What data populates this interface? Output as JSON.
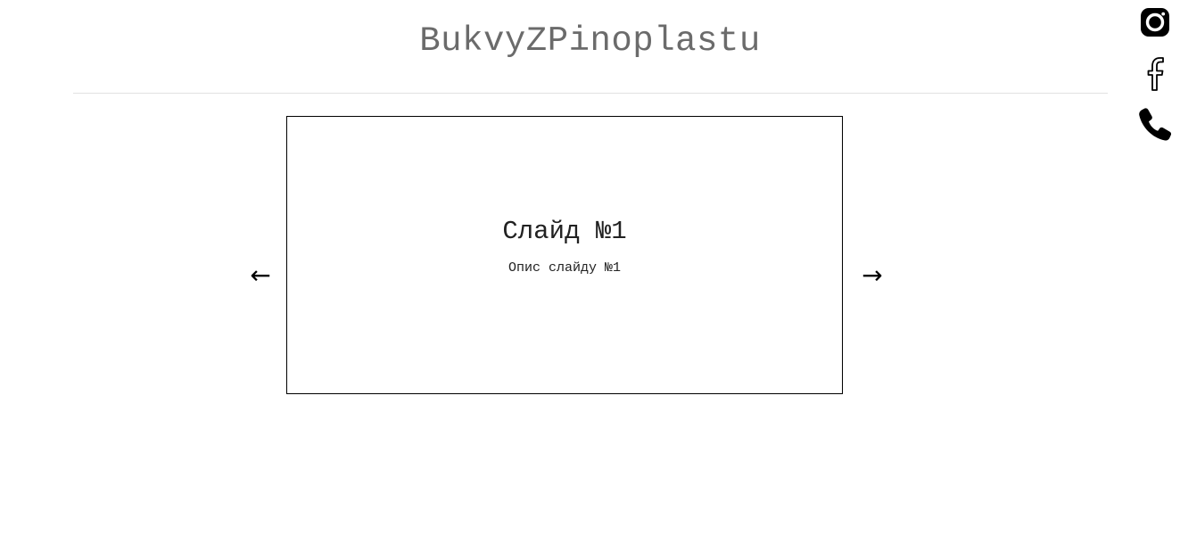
{
  "header": {
    "title": "BukvyZPinoplastu"
  },
  "social": {
    "icons": [
      "instagram-icon",
      "facebook-icon",
      "phone-icon"
    ]
  },
  "slider": {
    "prev_arrow": "←",
    "next_arrow": "→",
    "current_slide": {
      "title": "Слайд №1",
      "description": "Опис слайду №1"
    }
  },
  "colors": {
    "title": "#6b6b6b",
    "divider": "#e2e2e2",
    "slide_border": "#000000"
  }
}
